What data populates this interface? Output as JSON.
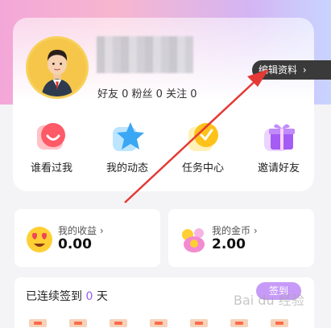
{
  "profile": {
    "stats_text": "好友 0 粉丝 0 关注 0",
    "edit_label": "编辑资料",
    "edit_chevron": "›"
  },
  "quick_actions": [
    {
      "label": "谁看过我",
      "icon": "heart-face-icon"
    },
    {
      "label": "我的动态",
      "icon": "star-icon"
    },
    {
      "label": "任务中心",
      "icon": "coin-check-icon"
    },
    {
      "label": "邀请好友",
      "icon": "gift-icon"
    }
  ],
  "income": {
    "title": "我的收益 ›",
    "value": "0.00",
    "icon": "heart-eyes-icon"
  },
  "coins": {
    "title": "我的金币 ›",
    "value": "2.00",
    "icon": "coin-bag-icon"
  },
  "checkin": {
    "title_prefix": "已连续签到 ",
    "days": "0",
    "title_suffix": " 天",
    "rules_label": "签到"
  },
  "watermark": "Bai du 经验",
  "colors": {
    "accent": "#9b59f5",
    "arrow": "#e53935"
  }
}
